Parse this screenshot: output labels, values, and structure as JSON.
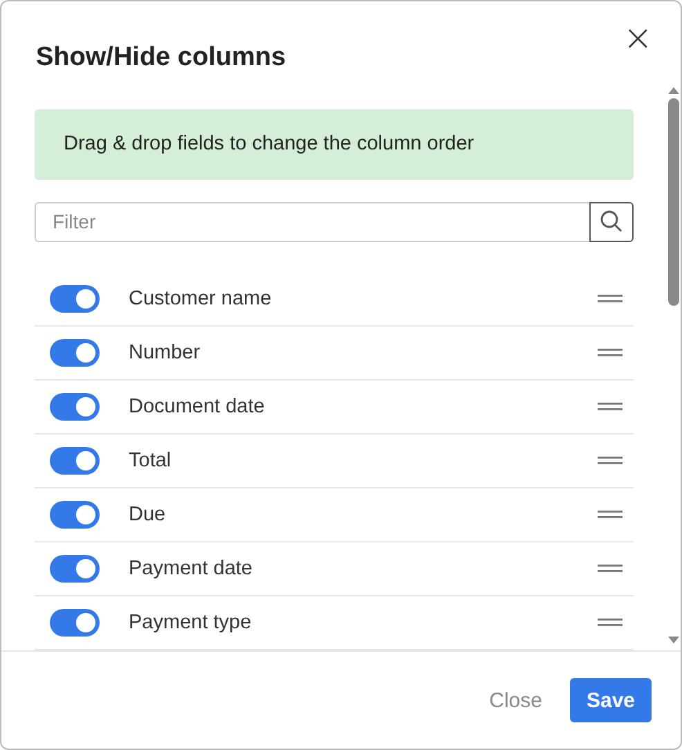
{
  "dialog": {
    "title": "Show/Hide columns",
    "close": "×"
  },
  "notice": "Drag & drop fields to change the column order",
  "filter": {
    "placeholder": "Filter"
  },
  "columns": [
    {
      "name": "Customer name",
      "on": true
    },
    {
      "name": "Number",
      "on": true
    },
    {
      "name": "Document date",
      "on": true
    },
    {
      "name": "Total",
      "on": true
    },
    {
      "name": "Due",
      "on": true
    },
    {
      "name": "Payment date",
      "on": true
    },
    {
      "name": "Payment type",
      "on": true
    }
  ],
  "buttons": {
    "close": "Close",
    "save": "Save"
  }
}
